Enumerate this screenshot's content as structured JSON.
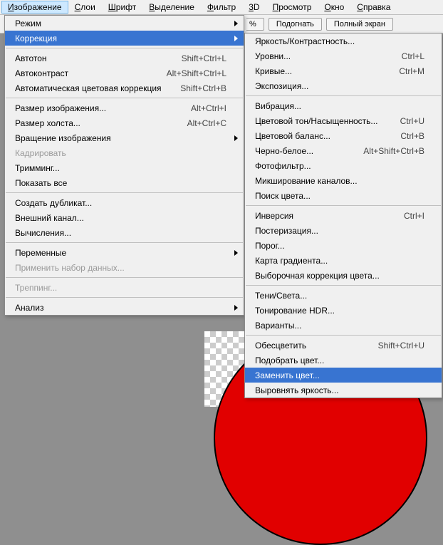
{
  "menubar": [
    {
      "label": "Изображение",
      "ul": 0,
      "active": true
    },
    {
      "label": "Слои",
      "ul": 0
    },
    {
      "label": "Шрифт",
      "ul": 0
    },
    {
      "label": "Выделение",
      "ul": 0
    },
    {
      "label": "Фильтр",
      "ul": 0
    },
    {
      "label": "3D",
      "ul": 0
    },
    {
      "label": "Просмотр",
      "ul": 0
    },
    {
      "label": "Окно",
      "ul": 0
    },
    {
      "label": "Справка",
      "ul": 0
    }
  ],
  "toolbar": {
    "fragment": "%",
    "fit": "Подогнать",
    "full": "Полный экран"
  },
  "leftMenu": [
    {
      "t": "sub",
      "label": "Режим"
    },
    {
      "t": "sub",
      "label": "Коррекция",
      "hl": true
    },
    {
      "t": "sep"
    },
    {
      "t": "item",
      "label": "Автотон",
      "sc": "Shift+Ctrl+L"
    },
    {
      "t": "item",
      "label": "Автоконтраст",
      "sc": "Alt+Shift+Ctrl+L"
    },
    {
      "t": "item",
      "label": "Автоматическая цветовая коррекция",
      "sc": "Shift+Ctrl+B"
    },
    {
      "t": "sep"
    },
    {
      "t": "item",
      "label": "Размер изображения...",
      "sc": "Alt+Ctrl+I"
    },
    {
      "t": "item",
      "label": "Размер холста...",
      "sc": "Alt+Ctrl+C"
    },
    {
      "t": "sub",
      "label": "Вращение изображения"
    },
    {
      "t": "item",
      "label": "Кадрировать",
      "disabled": true
    },
    {
      "t": "item",
      "label": "Тримминг..."
    },
    {
      "t": "item",
      "label": "Показать все"
    },
    {
      "t": "sep"
    },
    {
      "t": "item",
      "label": "Создать дубликат..."
    },
    {
      "t": "item",
      "label": "Внешний канал..."
    },
    {
      "t": "item",
      "label": "Вычисления..."
    },
    {
      "t": "sep"
    },
    {
      "t": "sub",
      "label": "Переменные"
    },
    {
      "t": "item",
      "label": "Применить набор данных...",
      "disabled": true
    },
    {
      "t": "sep"
    },
    {
      "t": "item",
      "label": "Треппинг...",
      "disabled": true
    },
    {
      "t": "sep"
    },
    {
      "t": "sub",
      "label": "Анализ"
    }
  ],
  "rightMenu": [
    {
      "t": "item",
      "label": "Яркость/Контрастность..."
    },
    {
      "t": "item",
      "label": "Уровни...",
      "sc": "Ctrl+L"
    },
    {
      "t": "item",
      "label": "Кривые...",
      "sc": "Ctrl+M"
    },
    {
      "t": "item",
      "label": "Экспозиция..."
    },
    {
      "t": "sep"
    },
    {
      "t": "item",
      "label": "Вибрация..."
    },
    {
      "t": "item",
      "label": "Цветовой тон/Насыщенность...",
      "sc": "Ctrl+U"
    },
    {
      "t": "item",
      "label": "Цветовой баланс...",
      "sc": "Ctrl+B"
    },
    {
      "t": "item",
      "label": "Черно-белое...",
      "sc": "Alt+Shift+Ctrl+B"
    },
    {
      "t": "item",
      "label": "Фотофильтр..."
    },
    {
      "t": "item",
      "label": "Микширование каналов..."
    },
    {
      "t": "item",
      "label": "Поиск цвета..."
    },
    {
      "t": "sep"
    },
    {
      "t": "item",
      "label": "Инверсия",
      "sc": "Ctrl+I"
    },
    {
      "t": "item",
      "label": "Постеризация..."
    },
    {
      "t": "item",
      "label": "Порог..."
    },
    {
      "t": "item",
      "label": "Карта градиента..."
    },
    {
      "t": "item",
      "label": "Выборочная коррекция цвета..."
    },
    {
      "t": "sep"
    },
    {
      "t": "item",
      "label": "Тени/Света..."
    },
    {
      "t": "item",
      "label": "Тонирование HDR..."
    },
    {
      "t": "item",
      "label": "Варианты..."
    },
    {
      "t": "sep"
    },
    {
      "t": "item",
      "label": "Обесцветить",
      "sc": "Shift+Ctrl+U"
    },
    {
      "t": "item",
      "label": "Подобрать цвет..."
    },
    {
      "t": "item",
      "label": "Заменить цвет...",
      "hl": true
    },
    {
      "t": "item",
      "label": "Выровнять яркость..."
    }
  ]
}
